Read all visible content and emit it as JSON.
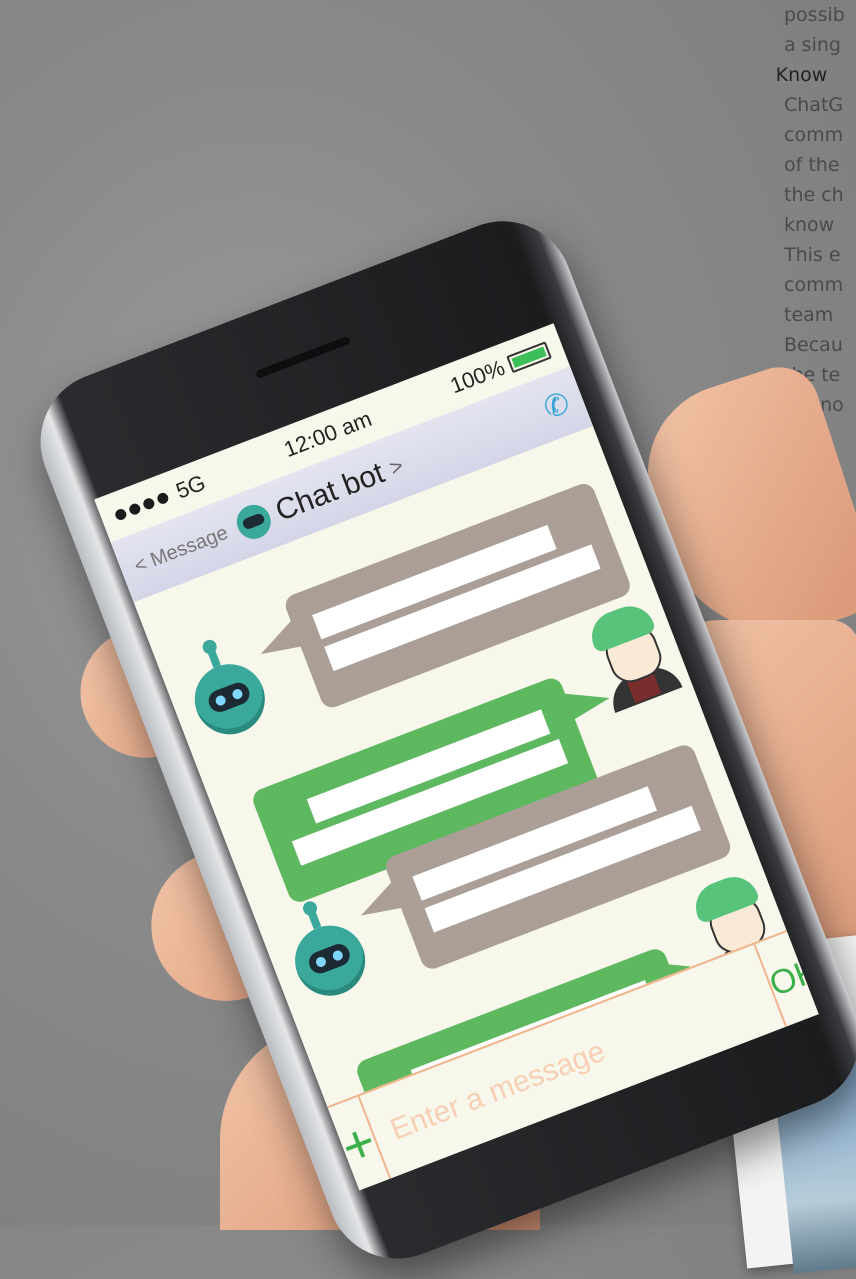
{
  "article": {
    "lines": [
      "possib",
      "a sing",
      "Know",
      "ChatG",
      "comm",
      "of the",
      "the ch",
      "know",
      "This e",
      "comm",
      "team",
      "Becau",
      "the te",
      "to kno"
    ]
  },
  "status_bar": {
    "carrier": "5G",
    "time": "12:00 am",
    "battery": "100%"
  },
  "nav": {
    "back_label": "< Message",
    "title": "Chat bot",
    "title_chevron": ">"
  },
  "input": {
    "placeholder": "Enter a message",
    "add_label": "+",
    "ok_label": "OK"
  },
  "colors": {
    "bot_bubble": "#ab9e97",
    "user_bubble": "#5db860",
    "accent_green": "#3bb04a",
    "input_border": "#f1b58d"
  }
}
